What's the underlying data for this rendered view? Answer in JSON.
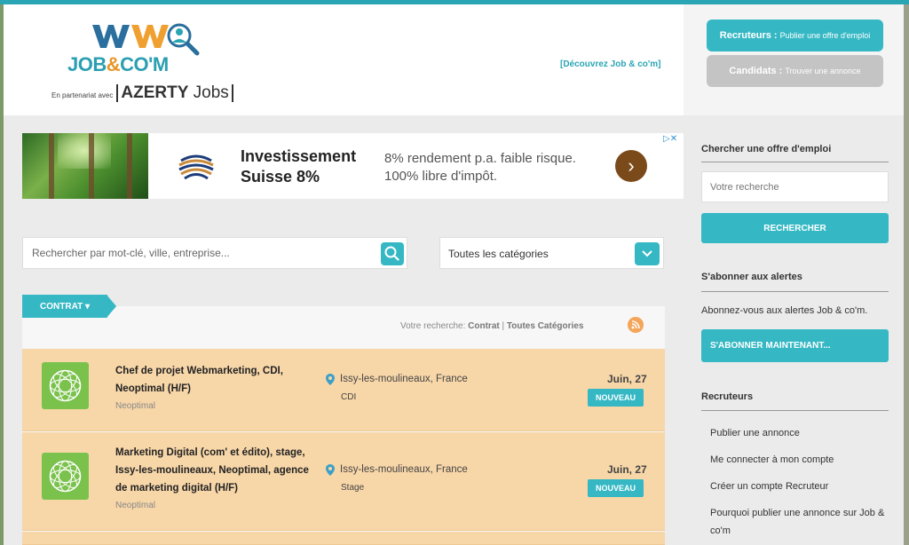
{
  "brand": {
    "logo_main": "JOB&CO'M",
    "logo_part1": "JOB",
    "logo_amp": "&",
    "logo_part2": "CO'M",
    "partner_label": "En partenariat avec",
    "partner_name_bold": "AZERTY",
    "partner_name_light": "Jobs",
    "discover_link": "[Découvrez Job & co'm]"
  },
  "header_buttons": {
    "recruteurs_bold": "Recruteurs :",
    "recruteurs_small": "Publier une offre d'emploi",
    "candidats_bold": "Candidats :",
    "candidats_small": "Trouver une annonce"
  },
  "ad": {
    "title": "Investissement Suisse 8%",
    "text": "8% rendement p.a. faible risque. 100% libre d'impôt.",
    "arrow": "›",
    "choices": "▷✕"
  },
  "search": {
    "keyword_placeholder": "Rechercher par mot-clé, ville, entreprise...",
    "category_value": "Toutes les catégories"
  },
  "results": {
    "tab_label": "CONTRAT ▾",
    "summary_prefix": "Votre recherche:",
    "summary_contract": "Contrat",
    "summary_sep": "|",
    "summary_category": "Toutes Catégories"
  },
  "jobs": [
    {
      "title": "Chef de projet Webmarketing, CDI, Neoptimal (H/F)",
      "company": "Neoptimal",
      "location": "Issy-les-moulineaux, France",
      "type": "CDI",
      "date": "Juin, 27",
      "badge": "NOUVEAU"
    },
    {
      "title": "Marketing Digital (com' et édito), stage, Issy-les-moulineaux, Neoptimal, agence de marketing digital (H/F)",
      "company": "Neoptimal",
      "location": "Issy-les-moulineaux, France",
      "type": "Stage",
      "date": "Juin, 27",
      "badge": "NOUVEAU"
    }
  ],
  "sidebar": {
    "search_heading": "Chercher une offre d'emploi",
    "search_placeholder": "Votre recherche",
    "search_button": "RECHERCHER",
    "alerts_heading": "S'abonner aux alertes",
    "alerts_text": "Abonnez-vous aux alertes Job & co'm.",
    "alerts_button": "S'ABONNER MAINTENANT...",
    "recruiters_heading": "Recruteurs",
    "recruiters_links": [
      "Publier une annonce",
      "Me connecter à mon compte",
      "Créer un compte Recruteur",
      "Pourquoi publier une annonce sur Job & co'm"
    ]
  },
  "colors": {
    "accent": "#35b8c4",
    "job_row": "#f7d6a8",
    "logo_green": "#7bc24d",
    "ad_arrow": "#7b4a1a"
  }
}
